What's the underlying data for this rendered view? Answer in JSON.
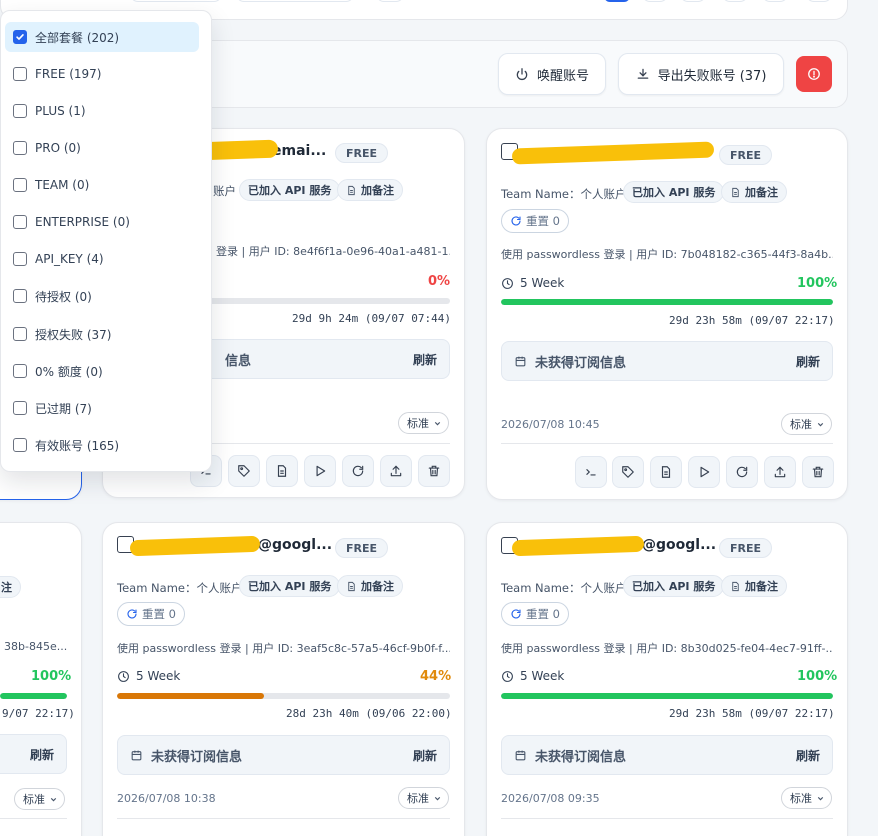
{
  "toolbar": {
    "wake_label": "唤醒账号",
    "export_label": "导出失败账号 (37)"
  },
  "filter_menu": {
    "items": [
      {
        "label": "全部套餐 (202)",
        "checked": true
      },
      {
        "label": "FREE (197)",
        "checked": false
      },
      {
        "label": "PLUS (1)",
        "checked": false
      },
      {
        "label": "PRO (0)",
        "checked": false
      },
      {
        "label": "TEAM (0)",
        "checked": false
      },
      {
        "label": "ENTERPRISE (0)",
        "checked": false
      },
      {
        "label": "API_KEY (4)",
        "checked": false
      },
      {
        "label": "待授权 (0)",
        "checked": false
      },
      {
        "label": "授权失败 (37)",
        "checked": false
      },
      {
        "label": "0% 额度 (0)",
        "checked": false
      },
      {
        "label": "已过期 (7)",
        "checked": false
      },
      {
        "label": "有效账号 (165)",
        "checked": false
      }
    ]
  },
  "cards": [
    {
      "email": "emai...",
      "plan": "FREE",
      "team_name_suffix": "账户",
      "api_chip": "已加入 API 服务",
      "note_chip": "加备注",
      "login_partial": "登录 | 用户 ID: 8e4f6f1a-0e96-40a1-a481-1...",
      "percent_text": "0%",
      "percent_value": 0,
      "countdown": "29d 9h 24m (09/07 07:44)",
      "sub_partial": "信息",
      "refresh": "刷新",
      "std": "标准"
    },
    {
      "email": "",
      "plan": "FREE",
      "team_name": "Team Name：个人账户",
      "api_chip": "已加入 API 服务",
      "note_chip": "加备注",
      "reset": "重置 0",
      "login": "使用 passwordless 登录 | 用户 ID: 7b048182-c365-44f3-8a4b...",
      "week": "5 Week",
      "percent_text": "100%",
      "percent_value": 100,
      "countdown": "29d 23h 58m (09/07 22:17)",
      "sub": "未获得订阅信息",
      "refresh": "刷新",
      "date": "2026/07/08 10:45",
      "std": "标准"
    },
    {
      "email": "@googl...",
      "plan": "FREE",
      "team_name": "Team Name：个人账户",
      "api_chip": "已加入 API 服务",
      "note_chip": "加备注",
      "reset": "重置 0",
      "login": "使用 passwordless 登录 | 用户 ID: 3eaf5c8c-57a5-46cf-9b0f-f...",
      "week": "5 Week",
      "percent_text": "44%",
      "percent_value": 44,
      "countdown": "28d 23h 40m (09/06 22:00)",
      "sub": "未获得订阅信息",
      "refresh": "刷新",
      "date": "2026/07/08 10:38",
      "std": "标准"
    },
    {
      "email": "@googl...",
      "plan": "FREE",
      "team_name": "Team Name：个人账户",
      "api_chip": "已加入 API 服务",
      "note_chip": "加备注",
      "reset": "重置 0",
      "login": "使用 passwordless 登录 | 用户 ID: 8b30d025-fe04-4ec7-91ff-...",
      "week": "5 Week",
      "percent_text": "100%",
      "percent_value": 100,
      "countdown": "29d 23h 58m (09/07 22:17)",
      "sub": "未获得订阅信息",
      "refresh": "刷新",
      "date": "2026/07/08 09:35",
      "std": "标准"
    },
    {
      "login_partial": "38b-845e...",
      "percent_text": "100%",
      "percent_value": 100,
      "countdown_partial": "9/07 22:17)",
      "refresh": "刷新",
      "std": "标准",
      "note_partial": "注"
    }
  ],
  "colors": {
    "accent": "#2563eb",
    "green": "#22c55e",
    "orange": "#e08a0b",
    "red": "#ef4444",
    "redaction": "#f9c00a"
  }
}
